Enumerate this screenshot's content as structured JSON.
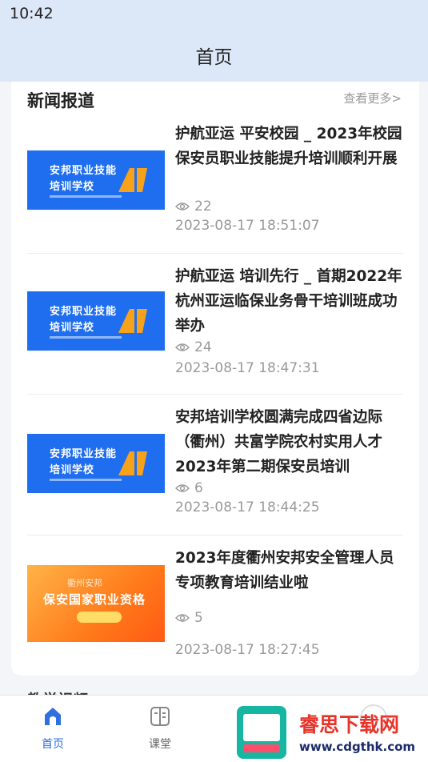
{
  "status_bar": {
    "time": "10:42"
  },
  "header": {
    "title": "首页"
  },
  "news_section": {
    "title": "新闻报道",
    "more_link": "查看更多>",
    "items": [
      {
        "title": "护航亚运 平安校园 _ 2023年校园保安员职业技能提升培训顺利开展",
        "views": "22",
        "date": "2023-08-17 18:51:07",
        "thumb_lines": [
          "安邦职业技能",
          "培训学校"
        ]
      },
      {
        "title": "护航亚运 培训先行 _ 首期2022年杭州亚运临保业务骨干培训班成功举办",
        "views": "24",
        "date": "2023-08-17 18:47:31",
        "thumb_lines": [
          "安邦职业技能",
          "培训学校"
        ]
      },
      {
        "title": "安邦培训学校圆满完成四省边际（衢州）共富学院农村实用人才2023年第二期保安员培训",
        "views": "6",
        "date": "2023-08-17 18:44:25",
        "thumb_lines": [
          "安邦职业技能",
          "培训学校"
        ]
      },
      {
        "title": "2023年度衢州安邦安全管理人员专项教育培训结业啦",
        "views": "5",
        "date": "2023-08-17 18:27:45",
        "thumb_lines": [
          "衢州安邦",
          "保安国家职业资格"
        ]
      }
    ]
  },
  "next_section": {
    "title": "教学视频"
  },
  "bottom_nav": {
    "items": [
      {
        "label": "首页",
        "icon": "home-icon",
        "active": true
      },
      {
        "label": "课堂",
        "icon": "classroom-icon",
        "active": false
      }
    ]
  },
  "watermark": {
    "title": "睿思下载网",
    "url": "www.cdgthk.com"
  },
  "colors": {
    "accent": "#2f6fe0",
    "header_bg": "#dce8f8",
    "watermark_red": "#e8342a"
  }
}
